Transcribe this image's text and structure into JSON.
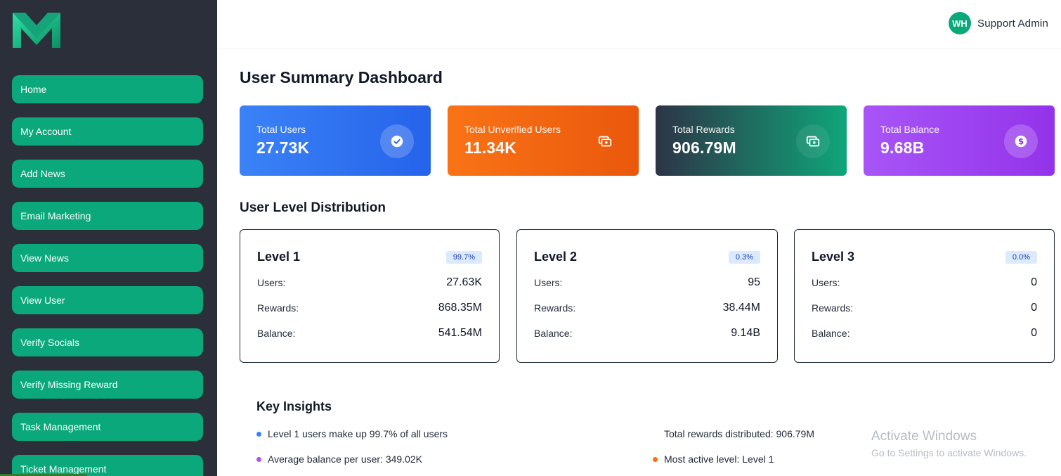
{
  "sidebar": {
    "items": [
      {
        "label": "Home"
      },
      {
        "label": "My Account"
      },
      {
        "label": "Add News"
      },
      {
        "label": "Email Marketing"
      },
      {
        "label": "View News"
      },
      {
        "label": "View User"
      },
      {
        "label": "Verify Socials"
      },
      {
        "label": "Verify Missing Reward"
      },
      {
        "label": "Task Management"
      },
      {
        "label": "Ticket Management"
      }
    ]
  },
  "header": {
    "avatar_initials": "WH",
    "user_name": "Support Admin"
  },
  "main": {
    "title": "User Summary Dashboard",
    "stats": [
      {
        "label": "Total Users",
        "value": "27.73K",
        "icon": "verified-badge-icon"
      },
      {
        "label": "Total Unverified Users",
        "value": "11.34K",
        "icon": "cash-icon"
      },
      {
        "label": "Total Rewards",
        "value": "906.79M",
        "icon": "cash-icon"
      },
      {
        "label": "Total Balance",
        "value": "9.68B",
        "icon": "dollar-icon"
      }
    ],
    "distribution_title": "User Level Distribution",
    "levels": [
      {
        "name": "Level 1",
        "percent": "99.7%",
        "users_label": "Users:",
        "users": "27.63K",
        "rewards_label": "Rewards:",
        "rewards": "868.35M",
        "balance_label": "Balance:",
        "balance": "541.54M"
      },
      {
        "name": "Level 2",
        "percent": "0.3%",
        "users_label": "Users:",
        "users": "95",
        "rewards_label": "Rewards:",
        "rewards": "38.44M",
        "balance_label": "Balance:",
        "balance": "9.14B"
      },
      {
        "name": "Level 3",
        "percent": "0.0%",
        "users_label": "Users:",
        "users": "0",
        "rewards_label": "Rewards:",
        "rewards": "0",
        "balance_label": "Balance:",
        "balance": "0"
      }
    ],
    "insights_title": "Key Insights",
    "insights": [
      {
        "text": "Level 1 users make up 99.7% of all users"
      },
      {
        "text": "Total rewards distributed: 906.79M"
      },
      {
        "text": "Average balance per user: 349.02K"
      },
      {
        "text": "Most active level: Level 1"
      }
    ]
  },
  "watermark": {
    "title": "Activate Windows",
    "subtitle": "Go to Settings to activate Windows."
  },
  "colors": {
    "sidebar_bg": "#2b2f3a",
    "nav_green": "#0aa87a",
    "blue": "#3b82f6",
    "orange": "#f97316",
    "purple": "#a855f7",
    "insight_blue": "#3b82f6",
    "insight_green": "#10b981",
    "insight_purple": "#a855f7",
    "insight_orange": "#f97316"
  }
}
